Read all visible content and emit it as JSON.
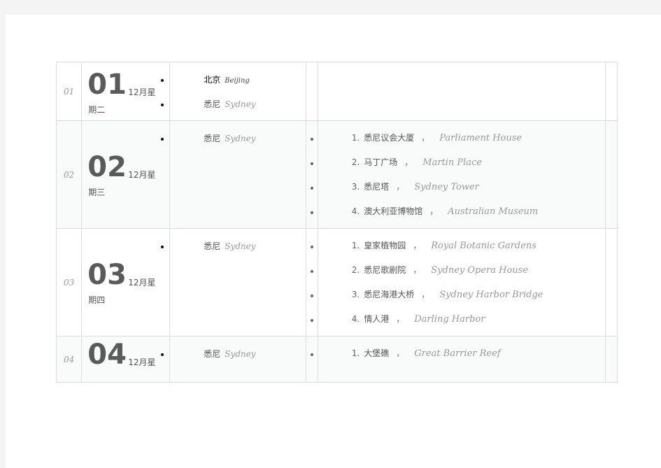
{
  "rows": [
    {
      "index": "01",
      "day": "01",
      "month": "12月星",
      "weekday": "期二",
      "cities": [
        {
          "zh": "北京",
          "en": "Beijing"
        },
        {
          "zh": "悉尼",
          "en": "Sydney"
        }
      ],
      "sights": []
    },
    {
      "index": "02",
      "day": "02",
      "month": "12月星",
      "weekday": "期三",
      "cities": [
        {
          "zh": "悉尼",
          "en": "Sydney"
        }
      ],
      "sights": [
        {
          "n": "1.",
          "zh": "悉尼议会大厦",
          "sep": "，",
          "en": "Parliament House"
        },
        {
          "n": "2.",
          "zh": "马丁广场",
          "sep": "，",
          "en": "Martin Place"
        },
        {
          "n": "3.",
          "zh": "悉尼塔",
          "sep": "，",
          "en": "Sydney Tower"
        },
        {
          "n": "4.",
          "zh": "澳大利亚博物馆",
          "sep": "，",
          "en": "Australian Museum"
        }
      ]
    },
    {
      "index": "03",
      "day": "03",
      "month": "12月星",
      "weekday": "期四",
      "cities": [
        {
          "zh": "悉尼",
          "en": "Sydney"
        }
      ],
      "sights": [
        {
          "n": "1.",
          "zh": "皇家植物园",
          "sep": "，",
          "en": "Royal Botanic Gardens"
        },
        {
          "n": "2.",
          "zh": "悉尼歌剧院",
          "sep": "，",
          "en": "Sydney Opera House"
        },
        {
          "n": "3.",
          "zh": "悉尼海港大桥",
          "sep": "，",
          "en": "Sydney Harbor Bridge"
        },
        {
          "n": "4.",
          "zh": "情人港",
          "sep": "，",
          "en": "Darling Harbor"
        }
      ]
    },
    {
      "index": "04",
      "day": "04",
      "month": "12月星",
      "weekday": "",
      "cities": [
        {
          "zh": "悉尼",
          "en": "Sydney"
        }
      ],
      "sights": [
        {
          "n": "1.",
          "zh": "大堡礁",
          "sep": "，",
          "en": "Great Barrier Reef"
        }
      ]
    }
  ]
}
